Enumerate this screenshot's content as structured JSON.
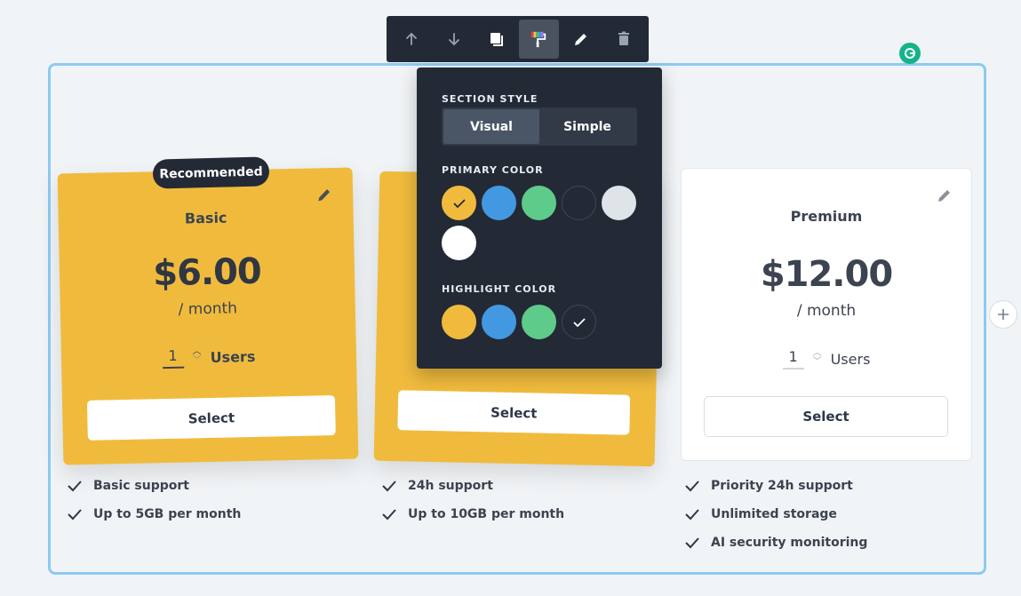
{
  "toolbar": {
    "buttons": [
      {
        "icon": "arrow-up-icon"
      },
      {
        "icon": "arrow-down-icon"
      },
      {
        "icon": "duplicate-icon"
      },
      {
        "icon": "paint-roller-icon",
        "active": true
      },
      {
        "icon": "pencil-icon"
      },
      {
        "icon": "trash-icon"
      }
    ]
  },
  "popover": {
    "section_style_label": "SECTION STYLE",
    "style_options": [
      "Visual",
      "Simple"
    ],
    "selected_style": "Visual",
    "primary_color_label": "PRIMARY COLOR",
    "primary_colors": [
      "#f0bb3d",
      "#4299e1",
      "#5fcb8a",
      "#232a36",
      "#dfe4e8",
      "#ffffff"
    ],
    "primary_selected": "#f0bb3d",
    "highlight_color_label": "HIGHLIGHT COLOR",
    "highlight_colors": [
      "#f0bb3d",
      "#4299e1",
      "#5fcb8a",
      "#232a36"
    ],
    "highlight_selected": "#232a36"
  },
  "plans": [
    {
      "name": "Basic",
      "badge": "Recommended",
      "price": "$6.00",
      "period": "/ month",
      "quantity": "1",
      "users_label": "Users",
      "button": "Select",
      "features": [
        "Basic support",
        "Up to 5GB per month"
      ]
    },
    {
      "button": "Select",
      "features": [
        "24h support",
        "Up to 10GB per month"
      ]
    },
    {
      "name": "Premium",
      "price": "$12.00",
      "period": "/ month",
      "quantity": "1",
      "users_label": "Users",
      "button": "Select",
      "features": [
        "Priority 24h support",
        "Unlimited storage",
        "AI security monitoring"
      ]
    }
  ],
  "colors": {
    "accent_yellow": "#f0bb3d",
    "dark": "#232a36",
    "frame_blue": "#8ccaf2"
  }
}
